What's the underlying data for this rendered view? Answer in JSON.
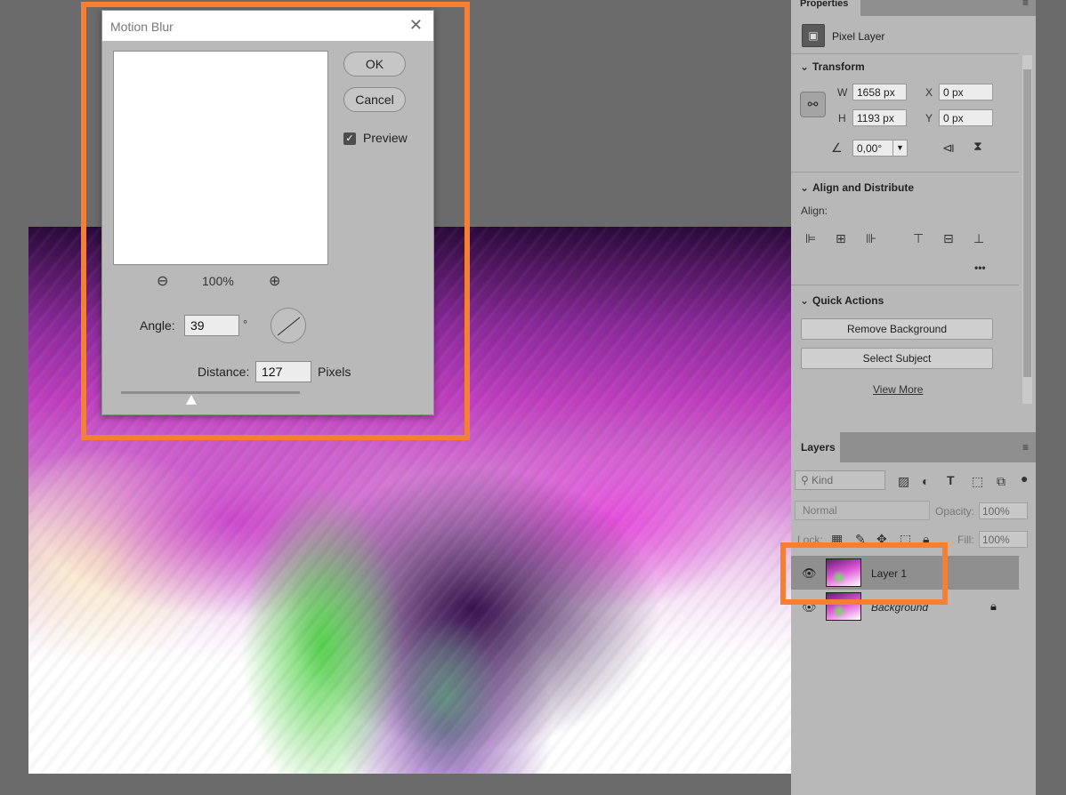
{
  "dialog": {
    "title": "Motion Blur",
    "ok_label": "OK",
    "cancel_label": "Cancel",
    "preview_label": "Preview",
    "preview_checked": true,
    "zoom_level": "100%",
    "angle_label": "Angle:",
    "angle_value": "39",
    "angle_unit": "°",
    "distance_label": "Distance:",
    "distance_value": "127",
    "distance_unit": "Pixels"
  },
  "properties": {
    "tab": "Properties",
    "layer_type": "Pixel Layer",
    "transform": {
      "title": "Transform",
      "w_label": "W",
      "w_value": "1658 px",
      "h_label": "H",
      "h_value": "1193 px",
      "x_label": "X",
      "x_value": "0 px",
      "y_label": "Y",
      "y_value": "0 px",
      "angle_value": "0,00°"
    },
    "align": {
      "title": "Align and Distribute",
      "align_label": "Align:",
      "more": "•••"
    },
    "quick_actions": {
      "title": "Quick Actions",
      "remove_bg": "Remove Background",
      "select_subject": "Select Subject",
      "view_more": "View More"
    }
  },
  "layers": {
    "tab": "Layers",
    "kind_placeholder": "Kind",
    "blend_mode": "Normal",
    "opacity_label": "Opacity:",
    "opacity_value": "100%",
    "lock_label": "Lock:",
    "fill_label": "Fill:",
    "fill_value": "100%",
    "items": [
      {
        "name": "Layer 1",
        "selected": true
      },
      {
        "name": "Background",
        "selected": false,
        "locked": true
      }
    ]
  },
  "colors": {
    "highlight": "#f57f32",
    "panel_bg": "#b8b8b8",
    "workspace": "#6b6b6b"
  }
}
